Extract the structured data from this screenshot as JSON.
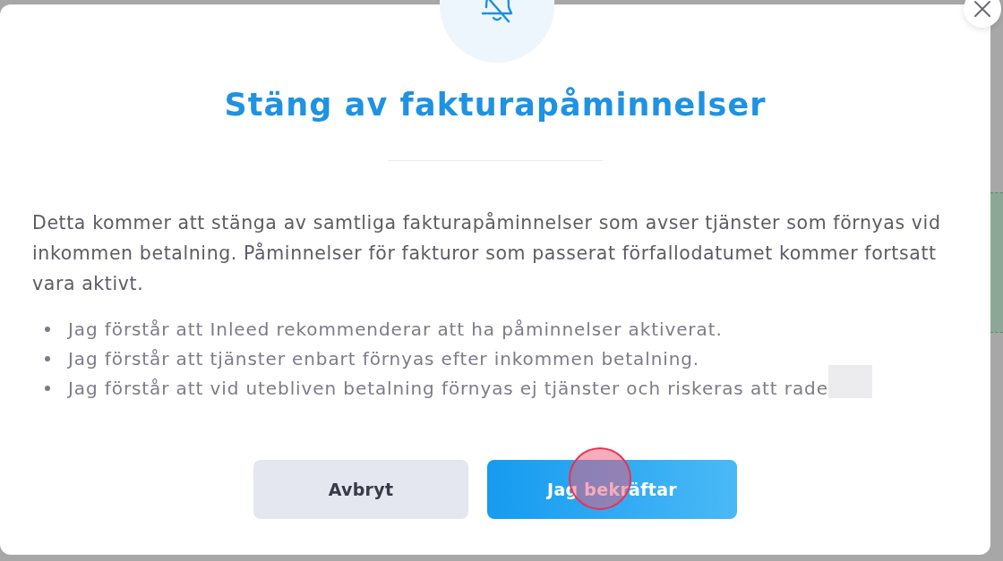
{
  "dialog": {
    "title": "Stäng av fakturapåminnelser",
    "description": "Detta kommer att stänga av samtliga fakturapåminnelser som avser tjänster som förnyas vid inkommen betalning. Påminnelser för fakturor som passerat förfallodatumet kommer fortsatt vara aktivt.",
    "acknowledgements": [
      {
        "text": "Jag förstår att Inleed rekommenderar att ha påminnelser aktiverat.",
        "redacted": false
      },
      {
        "text": "Jag förstår att tjänster enbart förnyas efter inkommen betalning.",
        "redacted": false
      },
      {
        "text": "Jag förstår att vid utebliven betalning förnyas ej tjänster och riskeras att rade",
        "redacted": true
      }
    ],
    "buttons": [
      {
        "kind": "secondary",
        "label": "Avbryt",
        "clicked": false
      },
      {
        "kind": "primary",
        "label": "Jag bekräftar",
        "clicked": true
      }
    ]
  }
}
